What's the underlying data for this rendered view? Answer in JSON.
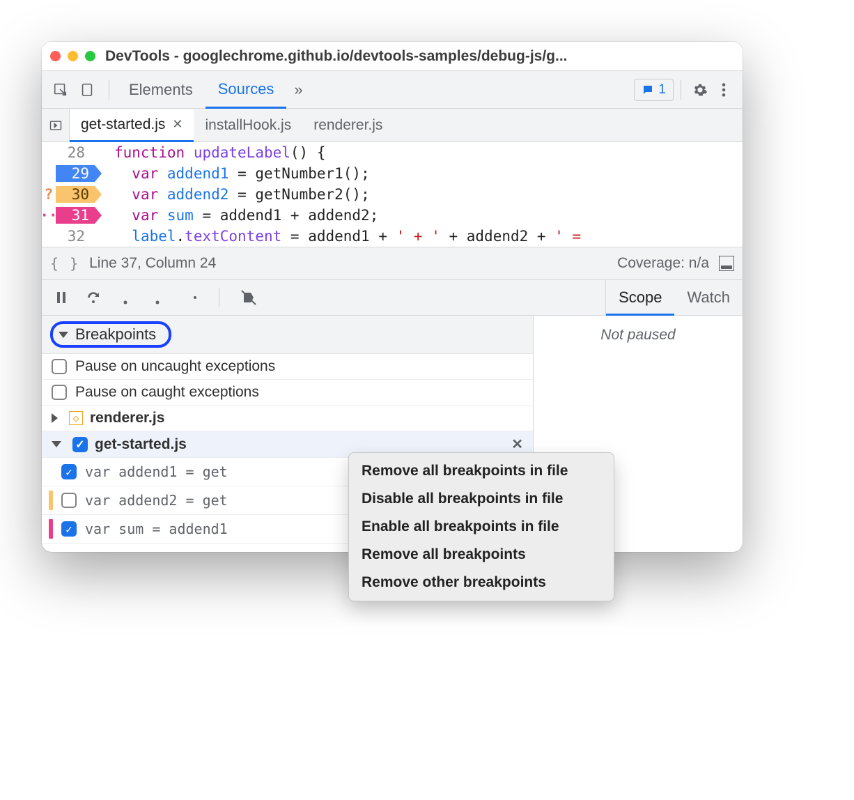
{
  "window": {
    "title": "DevTools - googlechrome.github.io/devtools-samples/debug-js/g..."
  },
  "toolbar": {
    "tabs": {
      "elements": "Elements",
      "sources": "Sources"
    },
    "feedback_count": "1"
  },
  "file_tabs": {
    "active": "get-started.js",
    "t1": "installHook.js",
    "t2": "renderer.js"
  },
  "code": {
    "l28": {
      "num": "28"
    },
    "l29": {
      "num": "29"
    },
    "l30": {
      "num": "30",
      "mark": "?"
    },
    "l31": {
      "num": "31",
      "mark": "··"
    },
    "l32": {
      "num": "32"
    }
  },
  "status": {
    "position": "Line 37, Column 24",
    "coverage": "Coverage: n/a"
  },
  "scope_watch": {
    "scope": "Scope",
    "watch": "Watch",
    "not_paused": "Not paused"
  },
  "breakpoints": {
    "header": "Breakpoints",
    "pause_uncaught": "Pause on uncaught exceptions",
    "pause_caught": "Pause on caught exceptions",
    "file_renderer": "renderer.js",
    "file_getstarted": "get-started.js",
    "item1": "var addend1 = get",
    "item2": "var addend2 = get",
    "item3": "var sum = addend1"
  },
  "context_menu": {
    "i1": "Remove all breakpoints in file",
    "i2": "Disable all breakpoints in file",
    "i3": "Enable all breakpoints in file",
    "i4": "Remove all breakpoints",
    "i5": "Remove other breakpoints"
  }
}
